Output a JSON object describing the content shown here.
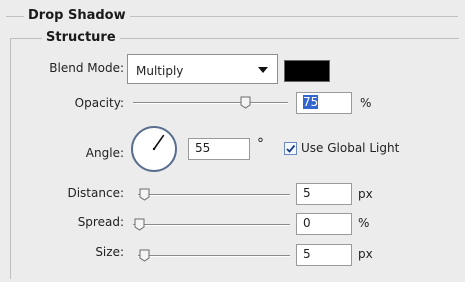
{
  "panel": {
    "section_title": "Drop Shadow",
    "group_title": "Structure"
  },
  "blend": {
    "label": "Blend Mode:",
    "value": "Multiply",
    "color": "#000000"
  },
  "opacity": {
    "label": "Opacity:",
    "value": "75",
    "unit": "%",
    "slider_fraction": 0.75
  },
  "angle": {
    "label": "Angle:",
    "value": "55",
    "unit": "°",
    "degrees": 55,
    "global_light_label": "Use Global Light",
    "global_light_checked": true
  },
  "distance": {
    "label": "Distance:",
    "value": "5",
    "unit": "px",
    "slider_fraction": 0.0
  },
  "spread": {
    "label": "Spread:",
    "value": "0",
    "unit": "%",
    "slider_fraction": 0.0
  },
  "size": {
    "label": "Size:",
    "value": "5",
    "unit": "px",
    "slider_fraction": 0.0
  }
}
